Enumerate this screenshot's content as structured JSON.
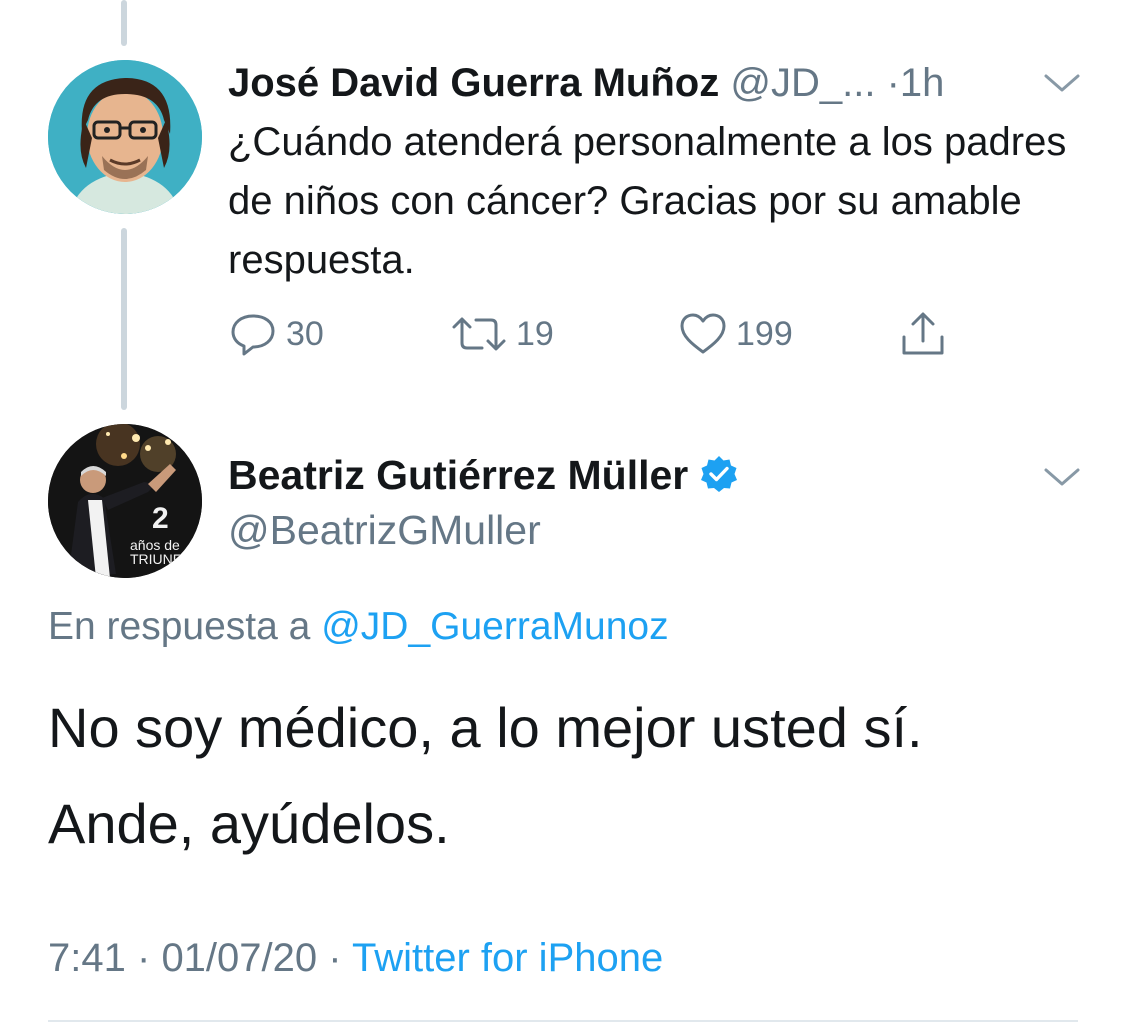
{
  "parent_tweet": {
    "author_name": "José David Guerra Muñoz",
    "author_handle": "@JD_...",
    "separator": "·",
    "time": "1h",
    "text": "¿Cuándo atenderá personalmente a los padres de niños con cáncer? Gracias por su amable respuesta.",
    "actions": {
      "reply_count": "30",
      "retweet_count": "19",
      "like_count": "199"
    }
  },
  "main_tweet": {
    "author_name": "Beatriz Gutiérrez Müller",
    "author_handle": "@BeatrizGMuller",
    "avatar_overlay": {
      "number": "2",
      "line1": "años de",
      "line2": "TRIUNFO"
    },
    "reply_prefix": "En respuesta a",
    "reply_mention": "@JD_GuerraMunoz",
    "text_line1": "No soy médico, a lo mejor usted sí.",
    "text_line2": "Ande, ayúdelos.",
    "time": "7:41",
    "date": "01/07/20",
    "separator": "·",
    "source": "Twitter for iPhone"
  },
  "colors": {
    "accent": "#1da1f2",
    "secondary_text": "#657786",
    "primary_text": "#14171a",
    "thread_line": "#ccd6dd"
  },
  "icons": {
    "reply": "reply-icon",
    "retweet": "retweet-icon",
    "like": "heart-icon",
    "share": "share-icon",
    "verified": "verified-badge-icon",
    "caret": "chevron-down-icon"
  }
}
